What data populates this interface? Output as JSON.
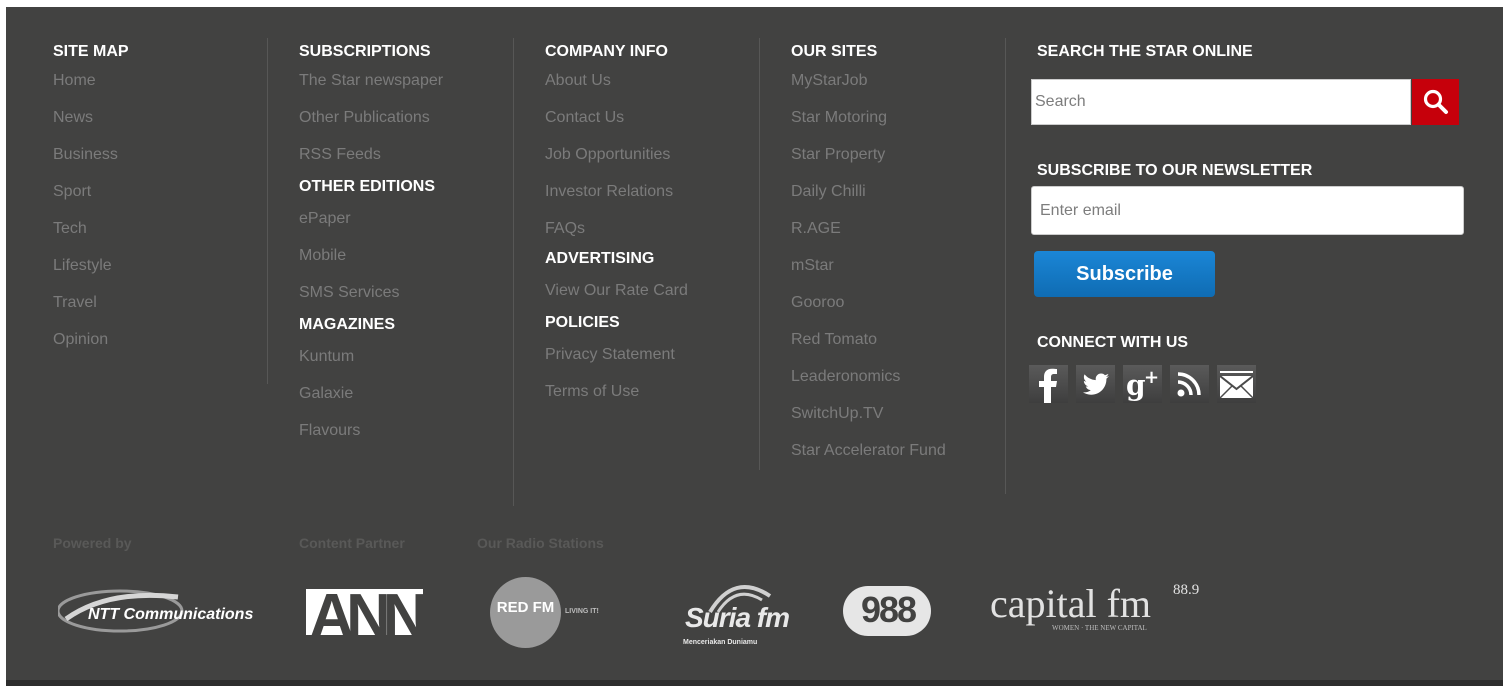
{
  "site_map": {
    "heading": "SITE MAP",
    "links": [
      "Home",
      "News",
      "Business",
      "Sport",
      "Tech",
      "Lifestyle",
      "Travel",
      "Opinion"
    ]
  },
  "subscriptions": {
    "heading": "SUBSCRIPTIONS",
    "links": [
      "The Star newspaper",
      "Other Publications",
      "RSS Feeds"
    ],
    "other_editions_heading": "OTHER EDITIONS",
    "other_editions": [
      "ePaper",
      "Mobile",
      "SMS Services"
    ],
    "magazines_heading": "MAGAZINES",
    "magazines": [
      "Kuntum",
      "Galaxie",
      "Flavours"
    ]
  },
  "company_info": {
    "heading": "COMPANY INFO",
    "links": [
      "About Us",
      "Contact Us",
      "Job Opportunities",
      "Investor Relations",
      "FAQs"
    ],
    "advertising_heading": "ADVERTISING",
    "advertising": [
      "View Our Rate Card"
    ],
    "policies_heading": "POLICIES",
    "policies": [
      "Privacy Statement",
      "Terms of Use"
    ]
  },
  "our_sites": {
    "heading": "OUR SITES",
    "links": [
      "MyStarJob",
      "Star Motoring",
      "Star Property",
      "Daily Chilli",
      "R.AGE",
      "mStar",
      "Gooroo",
      "Red Tomato",
      "Leaderonomics",
      "SwitchUp.TV",
      "Star Accelerator Fund"
    ]
  },
  "search": {
    "heading": "SEARCH THE STAR ONLINE",
    "placeholder": "Search",
    "button_icon": "search-icon"
  },
  "newsletter": {
    "heading": "SUBSCRIBE TO OUR NEWSLETTER",
    "placeholder": "Enter email",
    "button_label": "Subscribe"
  },
  "connect": {
    "heading": "CONNECT WITH US",
    "icons": [
      "facebook-icon",
      "twitter-icon",
      "google-plus-icon",
      "rss-icon",
      "email-icon"
    ]
  },
  "partners": {
    "powered_by": "Powered by",
    "content_partner": "Content Partner",
    "radio_stations": "Our Radio Stations",
    "ntt_logo": "NTT Communications",
    "ann_logo": "ANN",
    "red_fm_logo": "RED FM",
    "red_fm_tagline": "LIVING IT!",
    "suria_logo": "Suria fm",
    "suria_tagline": "Menceriakan Duniamu",
    "fm988_logo": "988",
    "capital_logo": "capital fm",
    "capital_freq": "88.9",
    "capital_tagline": "WOMEN · THE NEW CAPITAL"
  },
  "colors": {
    "background": "#424241",
    "heading": "#ffffff",
    "link": "#7b7b7b",
    "search_button": "#c6000b",
    "subscribe_button": "#1577c4"
  }
}
